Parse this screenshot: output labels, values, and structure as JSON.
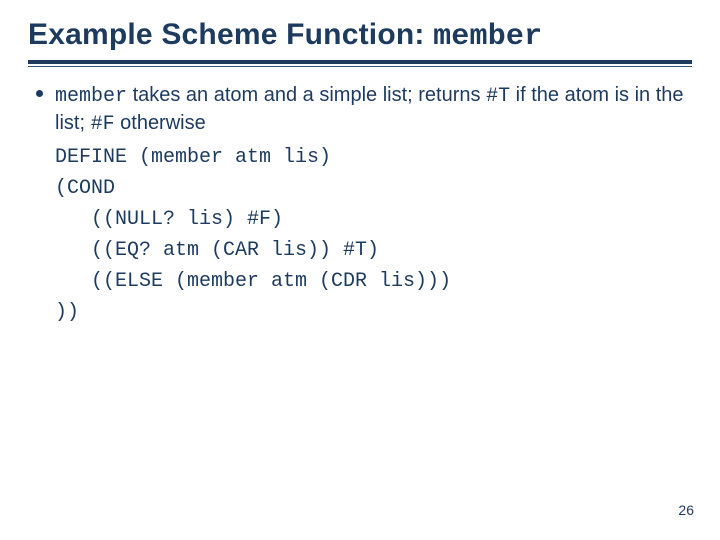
{
  "title": {
    "prefix": "Example Scheme Function: ",
    "mono": "member"
  },
  "bullet": {
    "desc": {
      "seg1_mono": "member",
      "seg2": " takes an atom and a simple list; returns ",
      "seg3_mono": "#T",
      "seg4": " if the atom is in the list; ",
      "seg5_mono": "#F",
      "seg6": " otherwise"
    },
    "code_lines": {
      "l1": "DEFINE (member atm lis)",
      "l2": "(COND",
      "l3": "   ((NULL? lis) #F)",
      "l4": "   ((EQ? atm (CAR lis)) #T)",
      "l5": "   ((ELSE (member atm (CDR lis)))",
      "l6": "))"
    }
  },
  "page_number": "26"
}
